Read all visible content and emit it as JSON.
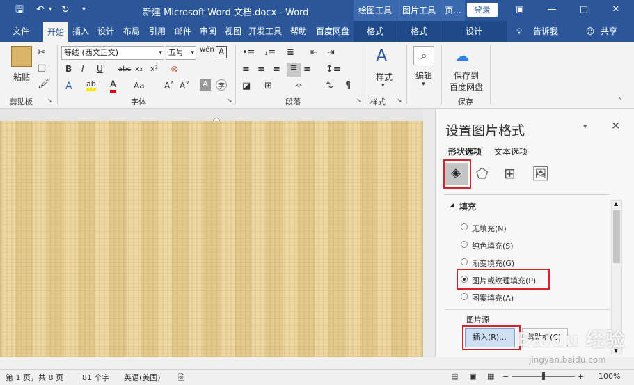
{
  "titlebar": {
    "title": "新建 Microsoft Word 文档.docx  -  Word",
    "ctx_drawing": "绘图工具",
    "ctx_picture": "图片工具",
    "ctx_page": "页...",
    "login": "登录",
    "save_icon": "save-icon",
    "undo_icon": "undo-icon",
    "redo_icon": "redo-icon"
  },
  "tabs": {
    "file": "文件",
    "home": "开始",
    "insert": "插入",
    "design": "设计",
    "layout": "布局",
    "references": "引用",
    "mailings": "邮件",
    "review": "审阅",
    "view": "视图",
    "developer": "开发工具",
    "help": "帮助",
    "baidu": "百度网盘",
    "format1": "格式",
    "format2": "格式",
    "design2": "设计",
    "tellme": "告诉我",
    "share": "共享"
  },
  "ribbon": {
    "paste": "粘贴",
    "clipboard": "剪贴板",
    "font_name": "等线 (西文正文)",
    "font_size": "五号",
    "font_group": "字体",
    "paragraph_group": "段落",
    "styles": "样式",
    "styles_group": "样式",
    "editing": "编辑",
    "save_baidu_line1": "保存到",
    "save_baidu_line2": "百度网盘",
    "save_group": "保存"
  },
  "pane": {
    "title": "设置图片格式",
    "tab_shape": "形状选项",
    "tab_text": "文本选项",
    "section_fill": "填充",
    "options": [
      "无填充(N)",
      "纯色填充(S)",
      "渐变填充(G)",
      "图片或纹理填充(P)",
      "图案填充(A)"
    ],
    "selected_option": "图片或纹理填充(P)",
    "picture_source": "图片源",
    "insert_btn": "插入(R)...",
    "clipboard_btn": "剪贴板(C)"
  },
  "status": {
    "page": "第 1 页，共 8 页",
    "words": "81 个字",
    "lang": "英语(美国)",
    "zoom": "100%"
  },
  "watermark": {
    "brand": "Baidu 经验",
    "url": "jingyan.baidu.com"
  }
}
